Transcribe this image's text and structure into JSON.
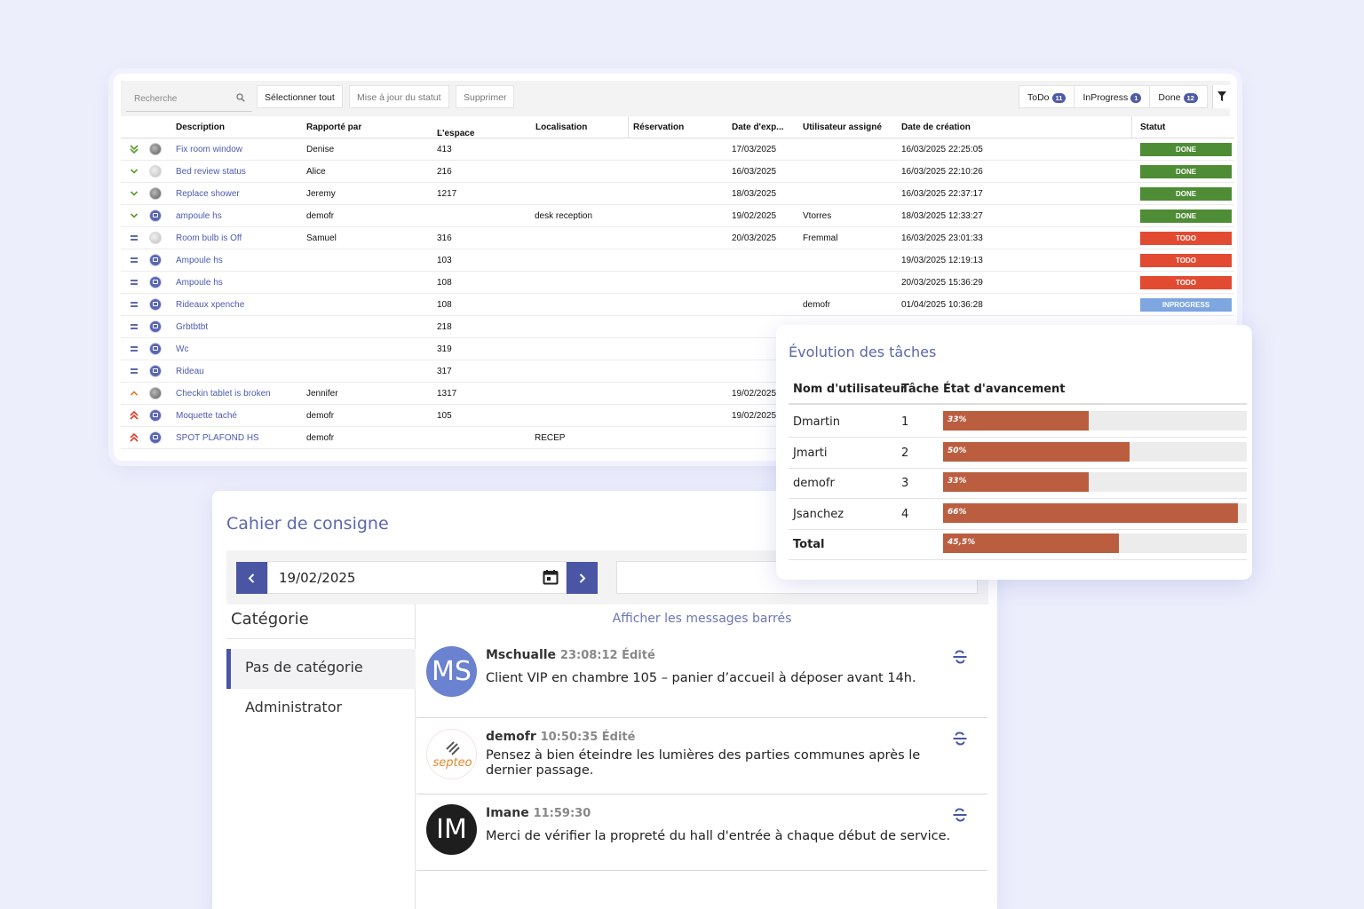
{
  "task_table": {
    "search_placeholder": "Recherche",
    "buttons": {
      "select_all": "Sélectionner tout",
      "update_status": "Mise à jour du statut",
      "delete": "Supprimer"
    },
    "status_tabs": [
      {
        "label": "ToDo",
        "count": "11"
      },
      {
        "label": "InProgress",
        "count": "1"
      },
      {
        "label": "Done",
        "count": "12"
      }
    ],
    "columns": [
      "Description",
      "Rapporté par",
      "L'espace",
      "Localisation",
      "Réservation",
      "Date d'exp...",
      "Utilisateur assigné",
      "Date de création",
      "Statut"
    ],
    "status_colors": {
      "DONE": "#4e8c35",
      "TODO": "#e24a32",
      "INPROGRESS": "#7ea6e0"
    },
    "rows": [
      {
        "priority": "double-chevron-down",
        "avatar": "photo",
        "description": "Fix room window",
        "reporter": "Denise",
        "space": "413",
        "location": "",
        "reservation": "",
        "expiry": "17/03/2025",
        "assigned": "",
        "created": "16/03/2025 22:25:05",
        "status": "DONE"
      },
      {
        "priority": "chevron-down",
        "avatar": "light",
        "description": "Bed review status",
        "reporter": "Alice",
        "space": "216",
        "location": "",
        "reservation": "",
        "expiry": "16/03/2025",
        "assigned": "",
        "created": "16/03/2025 22:10:26",
        "status": "DONE"
      },
      {
        "priority": "chevron-down",
        "avatar": "photo",
        "description": "Replace shower",
        "reporter": "Jeremy",
        "space": "1217",
        "location": "",
        "reservation": "",
        "expiry": "18/03/2025",
        "assigned": "",
        "created": "16/03/2025 22:37:17",
        "status": "DONE"
      },
      {
        "priority": "chevron-down",
        "avatar": "icon",
        "description": "ampoule hs",
        "reporter": "demofr",
        "space": "",
        "location": "desk reception",
        "reservation": "",
        "expiry": "19/02/2025",
        "assigned": "Vtorres",
        "created": "18/03/2025 12:33:27",
        "status": "DONE"
      },
      {
        "priority": "equals",
        "avatar": "light",
        "description": "Room bulb is Off",
        "reporter": "Samuel",
        "space": "316",
        "location": "",
        "reservation": "",
        "expiry": "20/03/2025",
        "assigned": "Fremmal",
        "created": "16/03/2025 23:01:33",
        "status": "TODO"
      },
      {
        "priority": "equals",
        "avatar": "icon",
        "description": "Ampoule hs",
        "reporter": "",
        "space": "103",
        "location": "",
        "reservation": "",
        "expiry": "",
        "assigned": "",
        "created": "19/03/2025 12:19:13",
        "status": "TODO"
      },
      {
        "priority": "equals",
        "avatar": "icon",
        "description": "Ampoule hs",
        "reporter": "",
        "space": "108",
        "location": "",
        "reservation": "",
        "expiry": "",
        "assigned": "",
        "created": "20/03/2025 15:36:29",
        "status": "TODO"
      },
      {
        "priority": "equals",
        "avatar": "icon",
        "description": "Rideaux xpenche",
        "reporter": "",
        "space": "108",
        "location": "",
        "reservation": "",
        "expiry": "",
        "assigned": "demofr",
        "created": "01/04/2025 10:36:28",
        "status": "INPROGRESS"
      },
      {
        "priority": "equals",
        "avatar": "icon",
        "description": "Grbtbtbt",
        "reporter": "",
        "space": "218",
        "location": "",
        "reservation": "",
        "expiry": "",
        "assigned": "",
        "created": "",
        "status": ""
      },
      {
        "priority": "equals",
        "avatar": "icon",
        "description": "Wc",
        "reporter": "",
        "space": "319",
        "location": "",
        "reservation": "",
        "expiry": "",
        "assigned": "",
        "created": "",
        "status": ""
      },
      {
        "priority": "equals",
        "avatar": "icon",
        "description": "Rideau",
        "reporter": "",
        "space": "317",
        "location": "",
        "reservation": "",
        "expiry": "",
        "assigned": "",
        "created": "",
        "status": ""
      },
      {
        "priority": "chevron-up",
        "avatar": "photo",
        "description": "Checkin tablet is broken",
        "reporter": "Jennifer",
        "space": "1317",
        "location": "",
        "reservation": "",
        "expiry": "19/02/2025",
        "assigned": "",
        "created": "",
        "status": ""
      },
      {
        "priority": "double-chevron-up",
        "avatar": "icon",
        "description": "Moquette taché",
        "reporter": "demofr",
        "space": "105",
        "location": "",
        "reservation": "",
        "expiry": "19/02/2025",
        "assigned": "",
        "created": "",
        "status": ""
      },
      {
        "priority": "double-chevron-up",
        "avatar": "icon",
        "description": "SPOT PLAFOND HS",
        "reporter": "demofr",
        "space": "",
        "location": "RECEP",
        "reservation": "",
        "expiry": "",
        "assigned": "",
        "created": "",
        "status": ""
      }
    ]
  },
  "logbook": {
    "title": "Cahier de consigne",
    "date": "19/02/2025",
    "category_title": "Catégorie",
    "categories": [
      {
        "label": "Pas de catégorie",
        "active": true
      },
      {
        "label": "Administrator",
        "active": false
      }
    ],
    "show_struck": "Afficher les messages barrés",
    "messages": [
      {
        "initials": "MS",
        "avatar_color": "#6a82cf",
        "author": "Mschualle",
        "meta": "23:08:12 Édité",
        "text": "Client VIP en chambre 105 – panier d’accueil à déposer avant 14h."
      },
      {
        "initials": "",
        "avatar_color": "#ffffff",
        "logo_text": "septeo",
        "author": "demofr",
        "meta": "10:50:35 Édité",
        "text": "Pensez à bien éteindre les lumières des parties communes après le dernier passage."
      },
      {
        "initials": "IM",
        "avatar_color": "#1e1e1e",
        "author": "Imane",
        "meta": "11:59:30",
        "text": "Merci de vérifier la propreté du hall d'entrée à chaque début de service."
      }
    ]
  },
  "evolution": {
    "title": "Évolution des tâches",
    "headers": [
      "Nom d'utilisateur",
      "Tâche",
      "État d'avancement"
    ],
    "bar_color": "#bb5e40",
    "rows": [
      {
        "name": "Dmartin",
        "task": "1",
        "progress_label": "33%",
        "progress": 0.48
      },
      {
        "name": "Jmarti",
        "task": "2",
        "progress_label": "50%",
        "progress": 0.615
      },
      {
        "name": "demofr",
        "task": "3",
        "progress_label": "33%",
        "progress": 0.48
      },
      {
        "name": "Jsanchez",
        "task": "4",
        "progress_label": "66%",
        "progress": 0.97
      }
    ],
    "total": {
      "name": "Total",
      "progress_label": "45,5%",
      "progress": 0.58
    }
  }
}
